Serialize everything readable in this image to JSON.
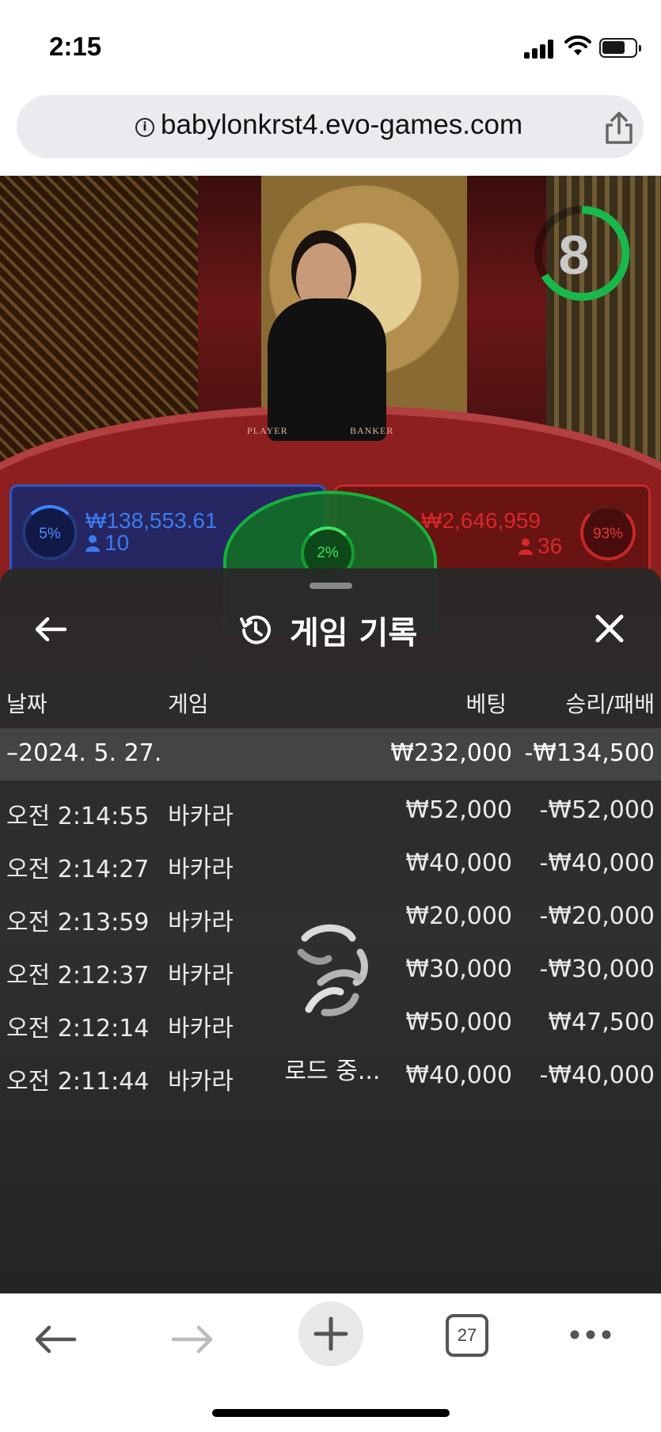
{
  "status": {
    "time": "2:15"
  },
  "browser": {
    "url": "babylonkrst4.evo-games.com",
    "tabs_count": "27"
  },
  "game_video": {
    "timer": "8",
    "table_labels": {
      "player": "PLAYER",
      "banker": "BANKER"
    },
    "player": {
      "percent": "5%",
      "amount": "₩138,553.61",
      "count": "10"
    },
    "tie": {
      "percent": "2%"
    },
    "banker": {
      "percent": "93%",
      "amount": "₩2,646,959",
      "count": "36"
    }
  },
  "history": {
    "title": "게임 기록",
    "headers": {
      "date": "날짜",
      "game": "게임",
      "bet": "베팅",
      "result": "승리/패배"
    },
    "date_group": {
      "date": "–2024. 5. 27.",
      "bet": "₩232,000",
      "result": "-₩134,500"
    },
    "rows": [
      {
        "time": "오전 2:14:55",
        "game": "바카라",
        "bet": "₩52,000",
        "result": "-₩52,000"
      },
      {
        "time": "오전 2:14:27",
        "game": "바카라",
        "bet": "₩40,000",
        "result": "-₩40,000"
      },
      {
        "time": "오전 2:13:59",
        "game": "바카라",
        "bet": "₩20,000",
        "result": "-₩20,000"
      },
      {
        "time": "오전 2:12:37",
        "game": "바카라",
        "bet": "₩30,000",
        "result": "-₩30,000"
      },
      {
        "time": "오전 2:12:14",
        "game": "바카라",
        "bet": "₩50,000",
        "result": "₩47,500"
      },
      {
        "time": "오전 2:11:44",
        "game": "바카라",
        "bet": "₩40,000",
        "result": "-₩40,000"
      }
    ],
    "loading_text": "로드 중..."
  },
  "colors": {
    "player": "#3a7cf0",
    "banker": "#d62828",
    "tie": "#16b23a"
  }
}
